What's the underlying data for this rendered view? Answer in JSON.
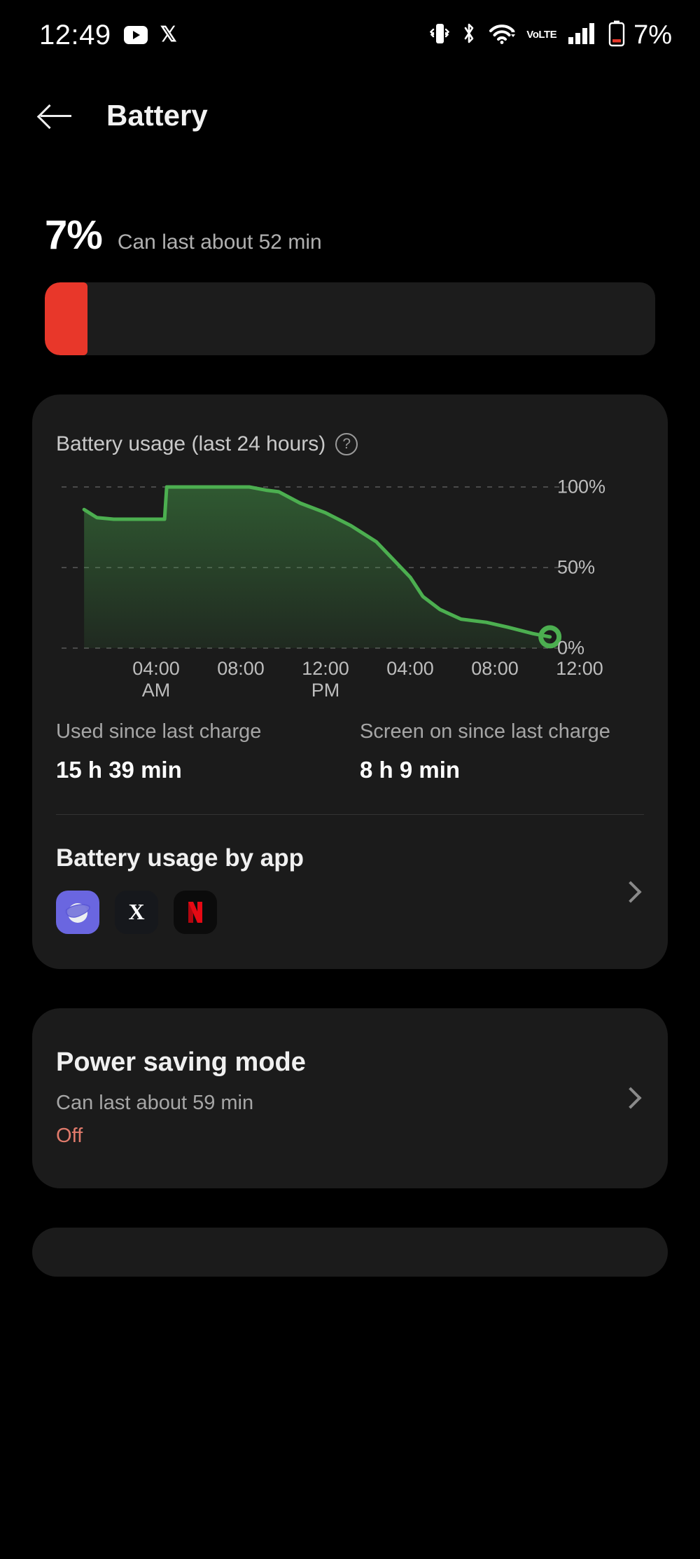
{
  "statusbar": {
    "clock": "12:49",
    "icons": [
      "youtube-icon",
      "x-icon",
      "vibrate-icon",
      "bluetooth-icon",
      "wifi-icon",
      "volte-icon",
      "signal-icon",
      "battery-icon"
    ],
    "volte_top": "Vo",
    "volte_bottom": "LTE",
    "battery_percent": "7%"
  },
  "appbar": {
    "title": "Battery",
    "back_icon": "back-arrow-icon"
  },
  "battery_level": {
    "percent_label": "7%",
    "estimate": "Can last about 52 min",
    "fill_ratio": 7,
    "fill_color": "#e8372a",
    "track_color": "#1c1c1c"
  },
  "usage_card": {
    "title": "Battery usage (last 24 hours)",
    "help_icon": "?",
    "stats": [
      {
        "label": "Used since last charge",
        "value": "15 h 39 min"
      },
      {
        "label": "Screen on since last charge",
        "value": "8 h 9 min"
      }
    ],
    "by_app": {
      "title": "Battery usage by app",
      "apps": [
        {
          "name": "samsung-internet",
          "glyph": ""
        },
        {
          "name": "x-twitter",
          "glyph": "X"
        },
        {
          "name": "netflix",
          "glyph": "N"
        }
      ],
      "chevron": "chevron-right-icon"
    }
  },
  "power_saving": {
    "title": "Power saving mode",
    "estimate": "Can last about 59 min",
    "state": "Off",
    "state_color": "#e07a6b",
    "chevron": "chevron-right-icon"
  },
  "chart_data": {
    "type": "area",
    "title": "Battery usage (last 24 hours)",
    "xlabel": "",
    "ylabel": "",
    "ylim": [
      0,
      100
    ],
    "xlim": [
      0,
      24
    ],
    "grid": true,
    "legend": null,
    "line_color": "#4caf50",
    "ytick_labels": [
      "100%",
      "50%",
      "0%"
    ],
    "ytick_values": [
      100,
      50,
      0
    ],
    "xtick_labels": [
      {
        "time": "04:00",
        "meridiem": "AM"
      },
      {
        "time": "08:00",
        "meridiem": ""
      },
      {
        "time": "12:00",
        "meridiem": "PM"
      },
      {
        "time": "04:00",
        "meridiem": ""
      },
      {
        "time": "08:00",
        "meridiem": ""
      },
      {
        "time": "12:00",
        "meridiem": ""
      }
    ],
    "xtick_hours": [
      4,
      8,
      12,
      16,
      20,
      24
    ],
    "x": [
      0.6,
      1.2,
      2.0,
      4.4,
      4.5,
      5.2,
      8.4,
      9.2,
      9.8,
      10.8,
      12.0,
      13.2,
      14.4,
      15.2,
      16.0,
      16.6,
      17.4,
      18.4,
      19.6,
      20.6,
      21.8,
      22.6
    ],
    "values": [
      86,
      81,
      80,
      80,
      100,
      100,
      100,
      98,
      97,
      90,
      84,
      76,
      66,
      55,
      44,
      32,
      24,
      18,
      16,
      13,
      9,
      7
    ],
    "end_marker": {
      "x": 22.6,
      "y": 7,
      "style": "ring",
      "color": "#4caf50"
    }
  }
}
